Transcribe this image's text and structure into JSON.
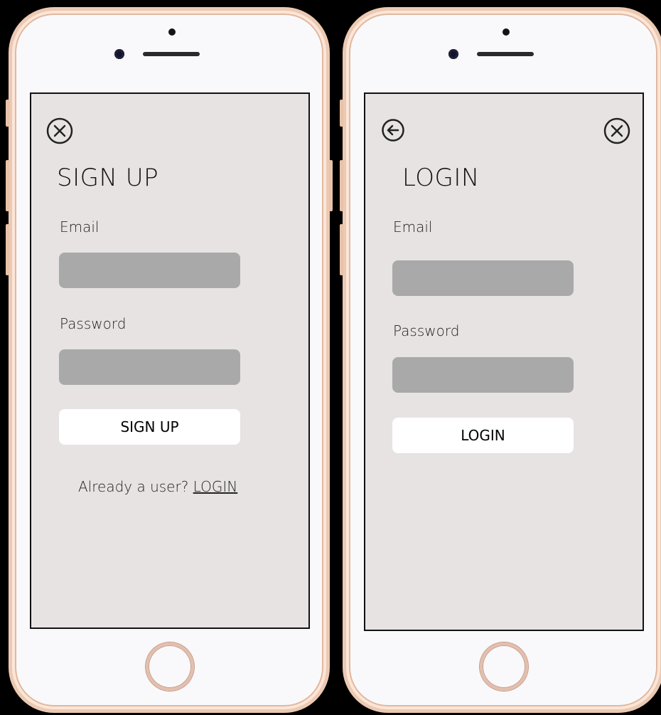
{
  "signup": {
    "title": "SIGN UP",
    "email_label": "Email",
    "email_value": "",
    "password_label": "Password",
    "password_value": "",
    "submit_label": "SIGN UP",
    "footer_prompt": "Already a user? ",
    "footer_link": "LOGIN",
    "close_icon": "close-circle-icon"
  },
  "login": {
    "title": "LOGIN",
    "email_label": "Email",
    "email_value": "",
    "password_label": "Password",
    "password_value": "",
    "submit_label": "LOGIN",
    "back_icon": "back-arrow-circle-icon",
    "close_icon": "close-circle-icon"
  },
  "colors": {
    "screen_bg": "#e8e3e3",
    "input_bg": "#a9a9a9",
    "button_bg": "#ffffff",
    "phone_frame": "#ecc9b2"
  }
}
